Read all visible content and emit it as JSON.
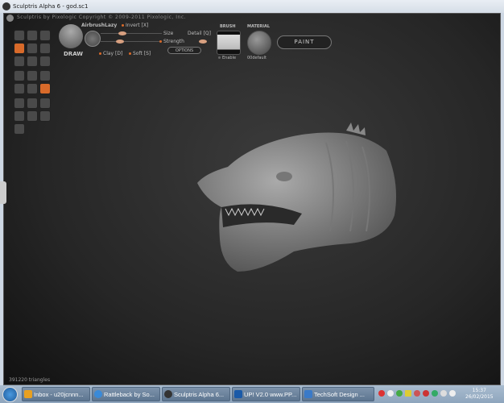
{
  "window": {
    "title": "Sculptris Alpha 6 - god.sc1"
  },
  "app": {
    "copyright": "Sculptris by Pixologic  Copyright © 2009-2011 Pixologic, Inc.",
    "tool": {
      "label": "DRAW"
    },
    "options": {
      "airbrush": "Airbrush",
      "lazy": "Lazy",
      "invert": "Invert [X]",
      "size": "Size",
      "detail": "Detail [Q]",
      "strength": "Strength",
      "clay": "Clay [D]",
      "soft": "Soft [S]",
      "options_button": "OPTIONS"
    },
    "brush": {
      "label": "BRUSH",
      "enable": "Enable"
    },
    "material": {
      "label": "MATERIAL",
      "name": "00default"
    },
    "paint_button": "PAINT",
    "status": "391220 triangles",
    "accent": "#d86a2a"
  },
  "taskbar": {
    "items": [
      {
        "label": "Inbox - u20jcnnn...",
        "color": "#e8a020"
      },
      {
        "label": "Rattleback by So...",
        "color": "#3a8ad8"
      },
      {
        "label": "Sculptris Alpha 6...",
        "color": "#333333"
      },
      {
        "label": "UP! V2.0 www.PP...",
        "color": "#1a5aa8"
      },
      {
        "label": "TechSoft Design ...",
        "color": "#3a7ac8"
      }
    ],
    "time": "15:37",
    "date": "26/02/2015"
  }
}
